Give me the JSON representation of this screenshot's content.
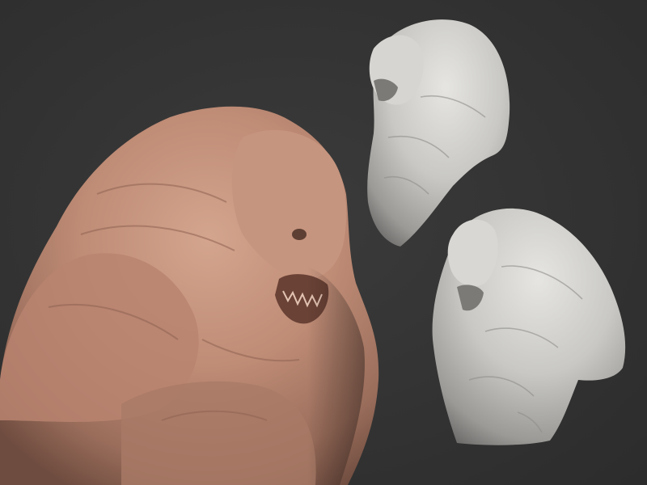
{
  "scene": {
    "background_color": "#343434",
    "views": [
      {
        "id": "main",
        "label": "",
        "material_color": "#c08f79"
      },
      {
        "id": "top-right",
        "label": "",
        "material_color": "#d2d1cd"
      },
      {
        "id": "bottom-right",
        "label": "",
        "material_color": "#d2d1cd"
      }
    ]
  }
}
